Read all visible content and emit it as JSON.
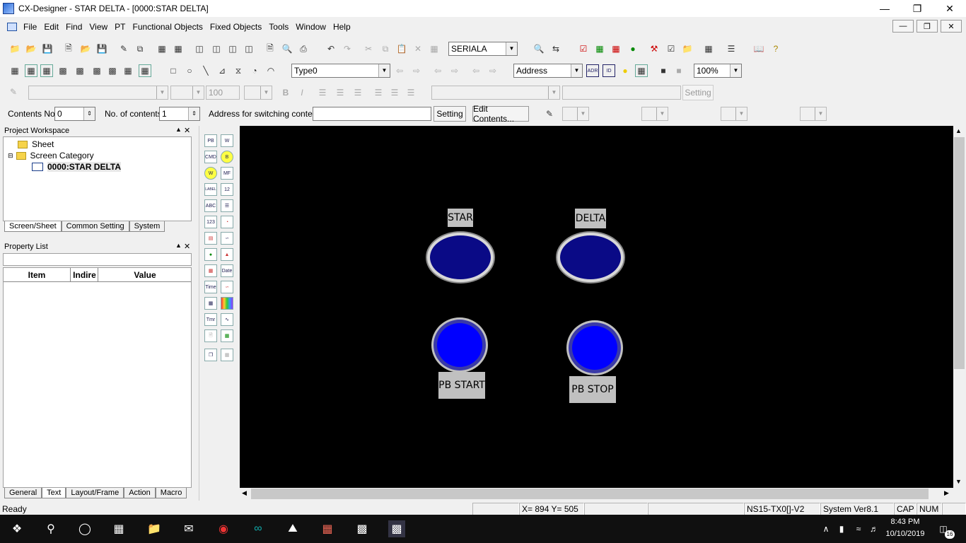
{
  "window": {
    "title": "CX-Designer - STAR DELTA - [0000:STAR DELTA]"
  },
  "menu": [
    "File",
    "Edit",
    "Find",
    "View",
    "PT",
    "Functional Objects",
    "Fixed Objects",
    "Tools",
    "Window",
    "Help"
  ],
  "toolbar1": {
    "port_combo": "SERIALA"
  },
  "toolbar2": {
    "type_combo": "Type0",
    "address_combo": "Address",
    "zoom_combo": "100%",
    "adr_label": "ADR",
    "id_label": "ID"
  },
  "toolbar3": {
    "font_size": "100",
    "setting_button": "Setting"
  },
  "toolbar4": {
    "contents_no_label": "Contents No.",
    "contents_no_value": "0",
    "no_of_contents_label": "No. of contents",
    "no_of_contents_value": "1",
    "address_switch_label": "Address for switching contents",
    "setting_button": "Setting",
    "edit_contents_button": "Edit Contents..."
  },
  "project_workspace": {
    "title": "Project Workspace",
    "tree": {
      "sheet": "Sheet",
      "screen_category": "Screen Category",
      "screen": "0000:STAR DELTA"
    },
    "tabs": [
      "Screen/Sheet",
      "Common Setting",
      "System"
    ]
  },
  "property_list": {
    "title": "Property List",
    "columns": [
      "Item",
      "Indire",
      "Value"
    ],
    "tabs": [
      "General",
      "Text",
      "Layout/Frame",
      "Action",
      "Macro"
    ]
  },
  "palette": {
    "labels": [
      "PB",
      "W",
      "CMD",
      "B",
      "W",
      "MF",
      "LABEL",
      "12",
      "ABC",
      "123",
      "Date",
      "Time",
      "Tmr"
    ]
  },
  "canvas": {
    "star_label": "STAR",
    "delta_label": "DELTA",
    "pb_start_label": "PB START",
    "pb_stop_label": "PB STOP"
  },
  "status": {
    "ready": "Ready",
    "coords": "X= 894 Y= 505",
    "pt_model": "NS15-TX0[]-V2",
    "system_ver": "System Ver8.1",
    "cap": "CAP",
    "num": "NUM"
  },
  "taskbar": {
    "time": "8:43 PM",
    "date": "10/10/2019",
    "notifications": "16"
  },
  "colors": {
    "canvas_bg": "#000000",
    "lamp": "#0a0a86",
    "pushbutton": "#0000ff",
    "tag": "#c0c0c0"
  }
}
